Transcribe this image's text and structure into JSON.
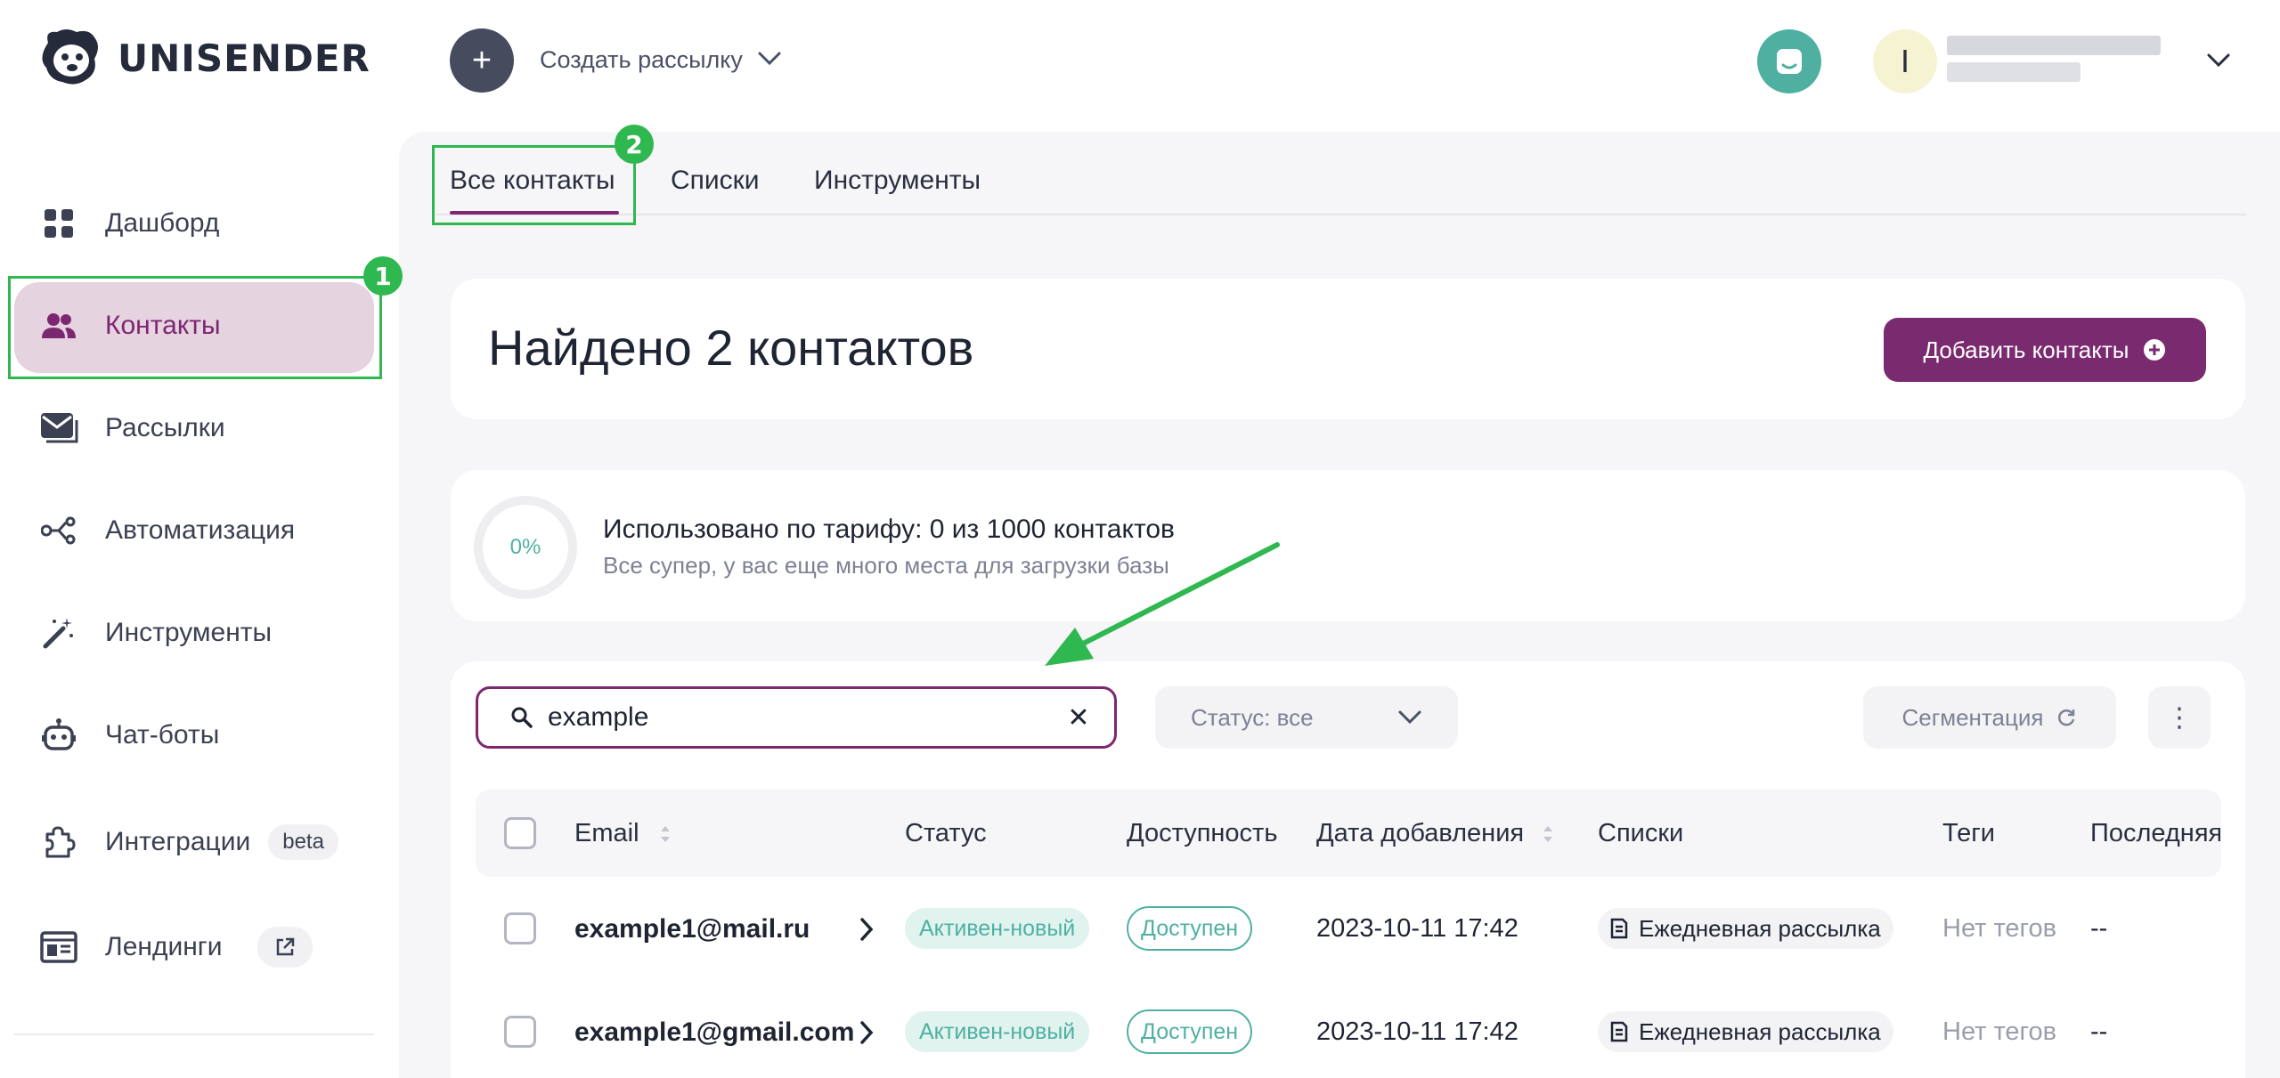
{
  "header": {
    "logo_text": "UNISENDER",
    "create_label": "Создать рассылку",
    "user_initial": "I"
  },
  "sidebar": {
    "items": [
      {
        "label": "Дашборд",
        "icon": "dashboard-grid-icon"
      },
      {
        "label": "Контакты",
        "icon": "people-icon"
      },
      {
        "label": "Рассылки",
        "icon": "mail-icon"
      },
      {
        "label": "Автоматизация",
        "icon": "workflow-icon"
      },
      {
        "label": "Инструменты",
        "icon": "magic-wand-icon"
      },
      {
        "label": "Чат-боты",
        "icon": "robot-icon"
      },
      {
        "label": "Интеграции",
        "icon": "puzzle-icon",
        "badge": "beta"
      },
      {
        "label": "Лендинги",
        "icon": "landing-page-icon"
      }
    ]
  },
  "annotations": {
    "first": "1",
    "second": "2"
  },
  "tabs": [
    {
      "label": "Все контакты"
    },
    {
      "label": "Списки"
    },
    {
      "label": "Инструменты"
    }
  ],
  "main": {
    "title": "Найдено 2 контактов",
    "add_button": "Добавить контакты",
    "usage": {
      "percent": "0%",
      "title": "Использовано по тарифу: 0 из 1000 контактов",
      "subtitle": "Все супер, у вас еще много места для загрузки базы"
    },
    "search": {
      "value": "example"
    },
    "status_filter": "Статус: все",
    "segmentation": "Сегментация"
  },
  "table": {
    "columns": [
      "Email",
      "Статус",
      "Доступность",
      "Дата добавления",
      "Списки",
      "Теги",
      "Последняя"
    ],
    "rows": [
      {
        "email": "example1@mail.ru",
        "status": "Активен-новый",
        "availability": "Доступен",
        "date": "2023-10-11 17:42",
        "list": "Ежедневная рассылка",
        "tags": "Нет тегов",
        "last": "--"
      },
      {
        "email": "example1@gmail.com",
        "status": "Активен-новый",
        "availability": "Доступен",
        "date": "2023-10-11 17:42",
        "list": "Ежедневная рассылка",
        "tags": "Нет тегов",
        "last": "--"
      }
    ]
  },
  "colors": {
    "brand": "#7d2770",
    "accent_teal": "#4fb0a2",
    "annotation_green": "#2eb84f"
  }
}
